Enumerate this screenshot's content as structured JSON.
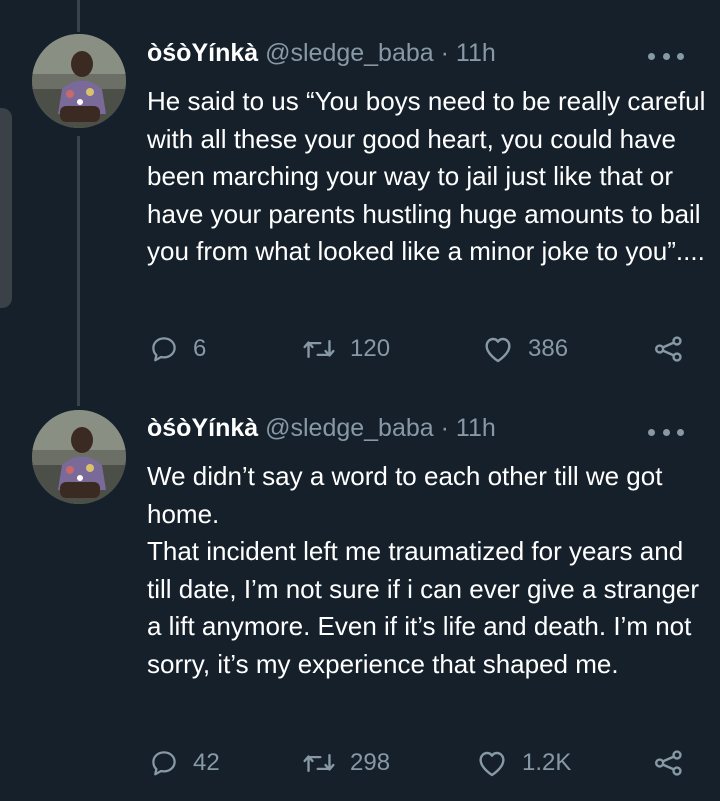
{
  "tweets": [
    {
      "name": "òśòYínkà",
      "handle": "@sledge_baba",
      "separator": "·",
      "time": "11h",
      "text": "He said to us “You boys need to be really careful with all these your good heart, you could have been marching your way to jail just like that or have your parents hustling huge amounts to bail you from what looked like a minor joke to you”....",
      "replies": "6",
      "retweets": "120",
      "likes": "386"
    },
    {
      "name": "òśòYínkà",
      "handle": "@sledge_baba",
      "separator": "·",
      "time": "11h",
      "text_line1": "We didn’t say a word to each other till we got home.",
      "text_line2": "That incident left me traumatized for years and till date, I’m not sure if i can ever give a stranger a lift anymore. Even if it’s life and death. I’m not sorry, it’s my experience that shaped me.",
      "replies": "42",
      "retweets": "298",
      "likes": "1.2K"
    }
  ],
  "icons": {
    "more": "more-icon",
    "reply": "reply-icon",
    "retweet": "retweet-icon",
    "like": "heart-icon",
    "share": "share-icon"
  },
  "colors": {
    "background": "#15202b",
    "secondary_text": "#8899a6",
    "thread_line": "#38444d"
  }
}
